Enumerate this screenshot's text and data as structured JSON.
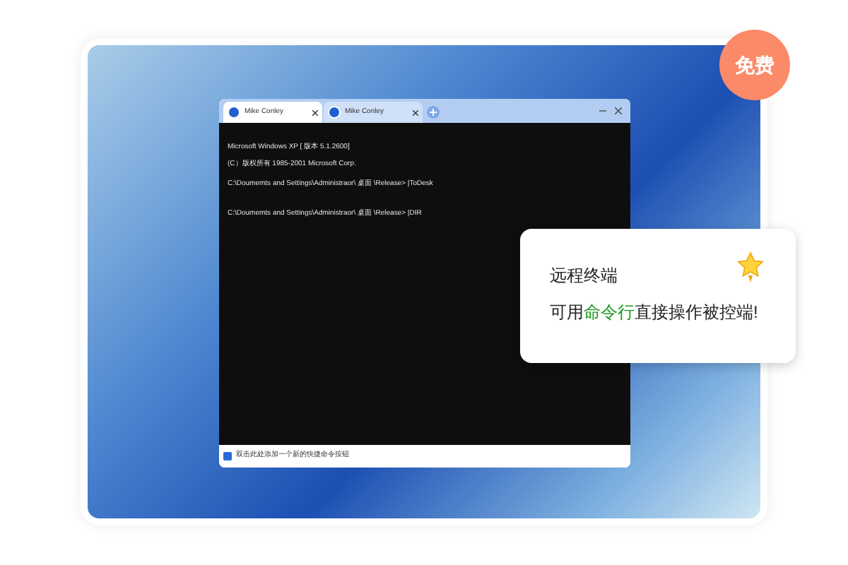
{
  "badge": {
    "label": "免费"
  },
  "terminal": {
    "tabs": [
      {
        "label": "Mike Conley",
        "selected": true
      },
      {
        "label": "Mike Conley",
        "selected": false
      }
    ],
    "lines": [
      "Microsoft Windows XP [ 版本 5.1.2600]",
      "(C）版权所有 1985-2001 Microsoft Corp.",
      "C:\\Doumemts and Settings\\Administraor\\ 桌面 \\Release> |ToDesk",
      "C:\\Doumemts and Settings\\Administraor\\ 桌面 \\Release> |DIR"
    ],
    "footer": "双击此处添加一个新的快捷命令按钮"
  },
  "callout": {
    "title": "远程终端",
    "parts": [
      {
        "text": "可用",
        "highlight": false
      },
      {
        "text": "命令行",
        "highlight": true
      },
      {
        "text": "直接操作被控端!",
        "highlight": false
      }
    ]
  }
}
